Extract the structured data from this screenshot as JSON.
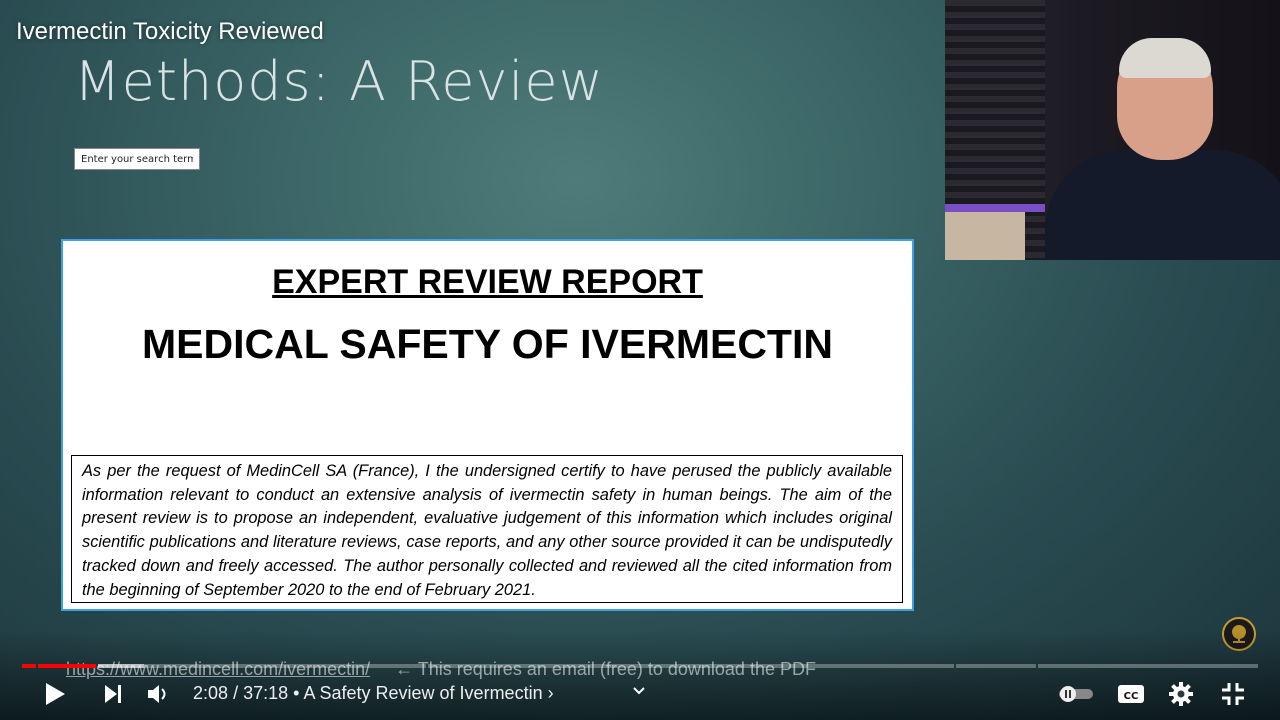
{
  "player": {
    "video_title": "Ivermectin Toxicity Reviewed",
    "time_current": "2:08",
    "time_total": "37:18",
    "time_separator": "/",
    "chapter_title": "A Safety Review of Ivermectin",
    "chapter_prefix": "•",
    "chapter_arrow": "›",
    "progress_played_fraction": 0.06,
    "icons": {
      "watch_later": "clock-icon",
      "share": "share-arrow-icon",
      "info": "info-icon",
      "play": "play-icon",
      "next": "skip-next-icon",
      "volume": "volume-icon",
      "chapters": "chevron-down-icon",
      "autoplay": "autoplay-toggle-icon",
      "captions": "cc-icon",
      "settings": "gear-icon",
      "fullscreen_exit": "exit-fullscreen-icon"
    },
    "accent_color": "#ff0000"
  },
  "slide": {
    "heading": "Methods:  A Review",
    "search": {
      "placeholder": "Enter your search term"
    },
    "document": {
      "heading_underlined": "EXPERT REVIEW REPORT",
      "title": "MEDICAL SAFETY OF IVERMECTIN",
      "body": "As per the request of MedinCell SA (France), I the undersigned certify to have perused the publicly available information relevant to conduct an extensive analysis of ivermectin safety in human beings. The aim of the present review is to propose an independent, evaluative judgement of this information which includes original scientific publications and literature reviews, case reports, and any other source provided it can be undisputedly tracked down and freely accessed. The author personally collected and reviewed all the cited information from the beginning of September 2020 to the end of February 2021."
    },
    "overlay_url": "https://www.medincell.com/ivermectin/",
    "overlay_note": "← This requires an email (free) to download the PDF"
  }
}
